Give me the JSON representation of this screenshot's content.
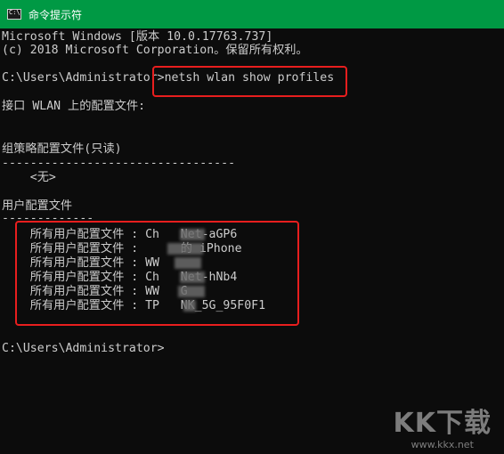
{
  "window": {
    "title": "命令提示符",
    "icon": "cmd-icon",
    "titlebar_color": "#009944"
  },
  "console": {
    "background": "#0c0c0c",
    "text_color": "#cccccc",
    "highlight_color": "#e81e1e",
    "lines": [
      "Microsoft Windows [版本 10.0.17763.737]",
      "(c) 2018 Microsoft Corporation。保留所有权利。",
      "",
      "C:\\Users\\Administrator>netsh wlan show profiles",
      "",
      "接口 WLAN 上的配置文件:",
      "",
      "",
      "组策略配置文件(只读)",
      "---------------------------------",
      "    <无>",
      "",
      "用户配置文件",
      "-------------",
      "    所有用户配置文件 : Ch   Net-aGP6",
      "    所有用户配置文件 :      的 iPhone",
      "    所有用户配置文件 : WW",
      "    所有用户配置文件 : Ch   Net-hNb4",
      "    所有用户配置文件 : WW   G",
      "    所有用户配置文件 : TP   NK_5G_95F0F1",
      "",
      "",
      "C:\\Users\\Administrator>"
    ]
  },
  "watermark": {
    "logo": "KK下载",
    "url": "www.kkx.net"
  }
}
